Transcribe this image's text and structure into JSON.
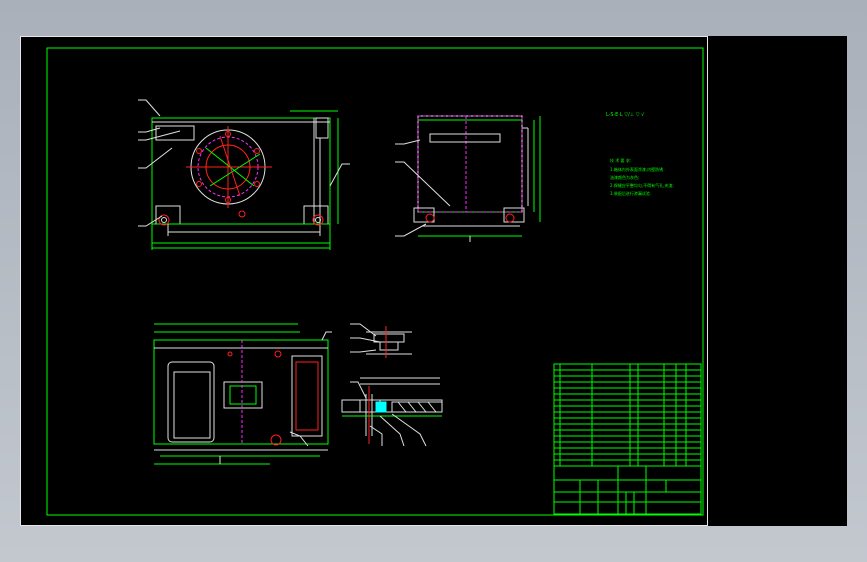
{
  "drawing": {
    "viewport_bg": "#000000",
    "line_color": "#00ff00",
    "outline_color": "#e0e0e0",
    "hidden_line_color": "#ff2aff",
    "center_line_color": "#ff2020",
    "dim_color": "#ffff00"
  }
}
